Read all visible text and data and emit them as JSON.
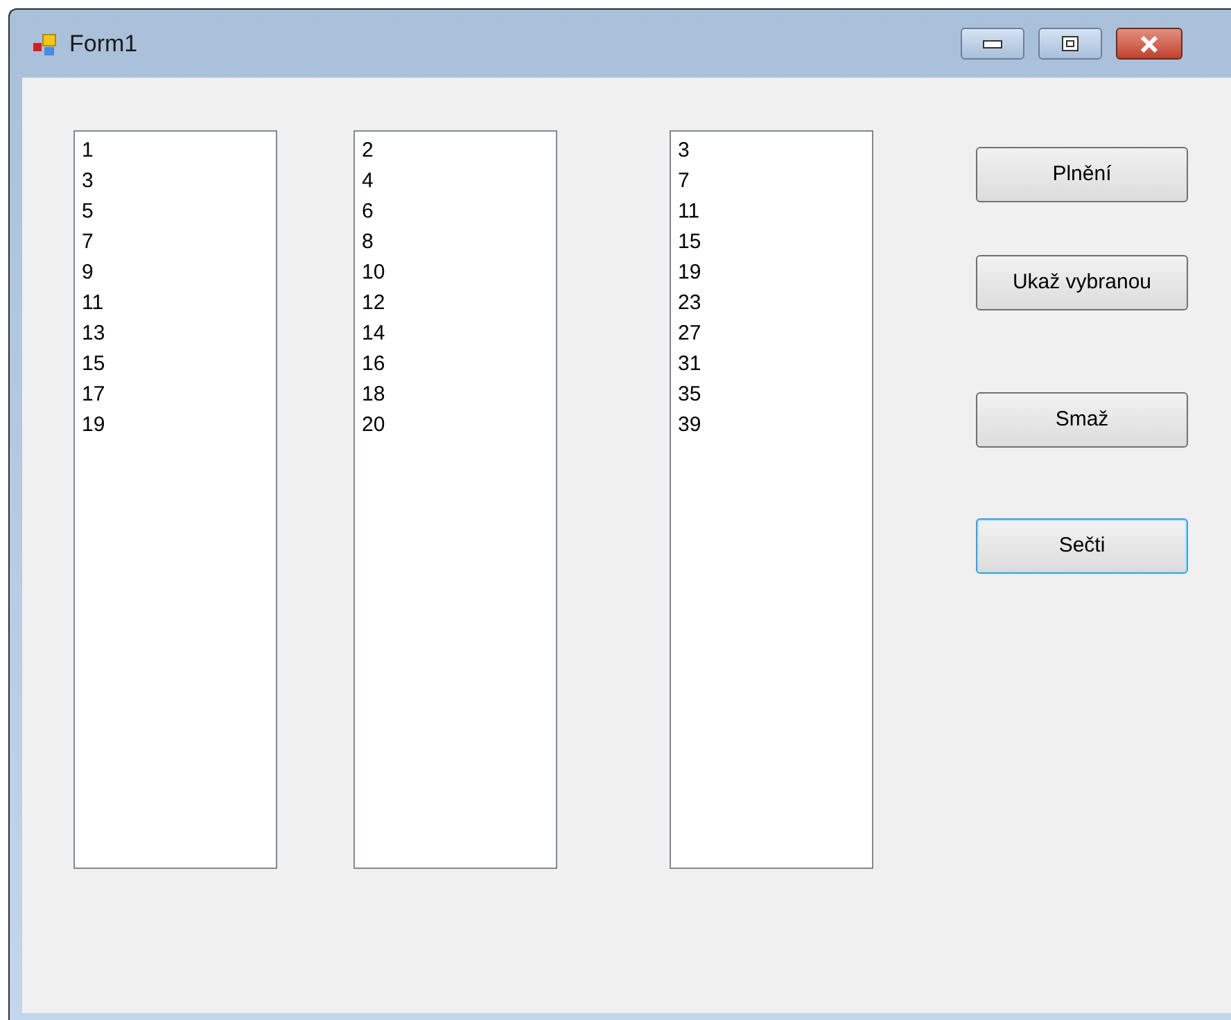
{
  "window": {
    "title": "Form1"
  },
  "listboxes": [
    {
      "items": [
        "1",
        "3",
        "5",
        "7",
        "9",
        "11",
        "13",
        "15",
        "17",
        "19"
      ]
    },
    {
      "items": [
        "2",
        "4",
        "6",
        "8",
        "10",
        "12",
        "14",
        "16",
        "18",
        "20"
      ]
    },
    {
      "items": [
        "3",
        "7",
        "11",
        "15",
        "19",
        "23",
        "27",
        "31",
        "35",
        "39"
      ]
    }
  ],
  "buttons": [
    {
      "label": "Plnění",
      "focused": false
    },
    {
      "label": "Ukaž vybranou",
      "focused": false
    },
    {
      "label": "Smaž",
      "focused": false
    },
    {
      "label": "Sečti",
      "focused": true
    }
  ]
}
